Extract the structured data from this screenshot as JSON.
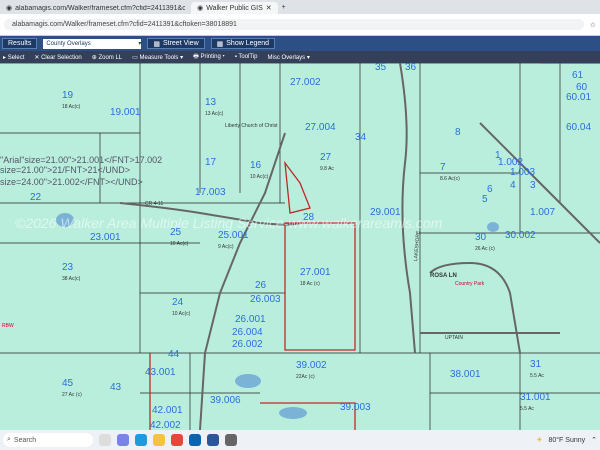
{
  "browser": {
    "tab1": "alabamagis.com/Walker/frameset.cfm?cfid=2411391&cftoken=38018891",
    "tab2": "Walker Public GIS",
    "url": "alabamagis.com/Walker/frameset.cfm?cfid=2411391&cftoken=38018891"
  },
  "toolbar1": {
    "results": "Results",
    "overlay_select": "County Overlays",
    "street_view": "Street View",
    "show_legend": "Show Legend"
  },
  "toolbar2": {
    "select": "Select",
    "clear_selection": "Clear Selection",
    "zoom": "Zoom LL",
    "measure": "Measure Tools",
    "printing": "Printing",
    "tooltip": "ToolTip",
    "misc": "Misc Overlays"
  },
  "map": {
    "watermark": "©2026 Walker Area Multiple Listing Service-www.walkerareamls.com",
    "church": "Liberty Church of Christ",
    "mobile_park": "Country Park",
    "roads": [
      "CR 4-11",
      "LAKESHORE",
      "UPTAIN",
      "ROSA LN",
      "RBW"
    ],
    "markup_text1": "\"Arial\"size=21.00\">21.001</FNT>17.002",
    "markup_text2": "size=21.00\">21/FNT>21</UND>",
    "markup_text3": "size=24.00\">21.002</FNT></UND>",
    "parcels": [
      {
        "id": "19",
        "ac": "18 Ac(c)"
      },
      {
        "id": "19.001",
        "ac": ""
      },
      {
        "id": "13",
        "ac": "13 Ac(c)"
      },
      {
        "id": "27.002",
        "ac": ""
      },
      {
        "id": "28",
        "ac": ""
      },
      {
        "id": "27.004",
        "ac": ""
      },
      {
        "id": "27",
        "ac": "9.8 Ac"
      },
      {
        "id": "16",
        "ac": "10 Ac(c)"
      },
      {
        "id": "17",
        "ac": ""
      },
      {
        "id": "17.003",
        "ac": ""
      },
      {
        "id": "22",
        "ac": ""
      },
      {
        "id": "23.001",
        "ac": ""
      },
      {
        "id": "23",
        "ac": "38 Ac(c)"
      },
      {
        "id": "25",
        "ac": "10 Ac(c)"
      },
      {
        "id": "25.001",
        "ac": "9 Ac(c)"
      },
      {
        "id": "24",
        "ac": "10 Ac(c)"
      },
      {
        "id": "26",
        "ac": ""
      },
      {
        "id": "26.003",
        "ac": ""
      },
      {
        "id": "26.001",
        "ac": ""
      },
      {
        "id": "26.004",
        "ac": ""
      },
      {
        "id": "26.002",
        "ac": ""
      },
      {
        "id": "27.001",
        "ac": "18 Ac (c)"
      },
      {
        "id": "29.001",
        "ac": ""
      },
      {
        "id": "39.002",
        "ac": "22Ac (c)"
      },
      {
        "id": "39.006",
        "ac": ""
      },
      {
        "id": "39.003",
        "ac": ""
      },
      {
        "id": "44",
        "ac": ""
      },
      {
        "id": "43.001",
        "ac": ""
      },
      {
        "id": "43",
        "ac": ""
      },
      {
        "id": "42.001",
        "ac": ""
      },
      {
        "id": "42.002",
        "ac": ""
      },
      {
        "id": "45",
        "ac": "27 Ac (c)"
      },
      {
        "id": "7",
        "ac": "8.6 Ac(c)"
      },
      {
        "id": "8",
        "ac": ""
      },
      {
        "id": "30",
        "ac": "26 Ac (c)"
      },
      {
        "id": "30.002",
        "ac": ""
      },
      {
        "id": "31",
        "ac": "5.5 Ac"
      },
      {
        "id": "31.001",
        "ac": "5.5 Ac"
      },
      {
        "id": "38.001",
        "ac": ""
      },
      {
        "id": "61",
        "ac": ""
      },
      {
        "id": "60",
        "ac": ""
      },
      {
        "id": "60.01",
        "ac": ""
      },
      {
        "id": "60.04",
        "ac": ""
      },
      {
        "id": "1",
        "ac": ""
      },
      {
        "id": "1.002",
        "ac": ""
      },
      {
        "id": "1.003",
        "ac": ""
      },
      {
        "id": "1.007",
        "ac": ""
      },
      {
        "id": "6",
        "ac": ""
      },
      {
        "id": "5",
        "ac": ""
      },
      {
        "id": "3",
        "ac": ""
      },
      {
        "id": "4",
        "ac": ""
      },
      {
        "id": "35",
        "ac": ""
      },
      {
        "id": "36",
        "ac": ""
      },
      {
        "id": "34",
        "ac": ""
      }
    ]
  },
  "taskbar": {
    "search": "Search",
    "weather": "80°F  Sunny"
  }
}
